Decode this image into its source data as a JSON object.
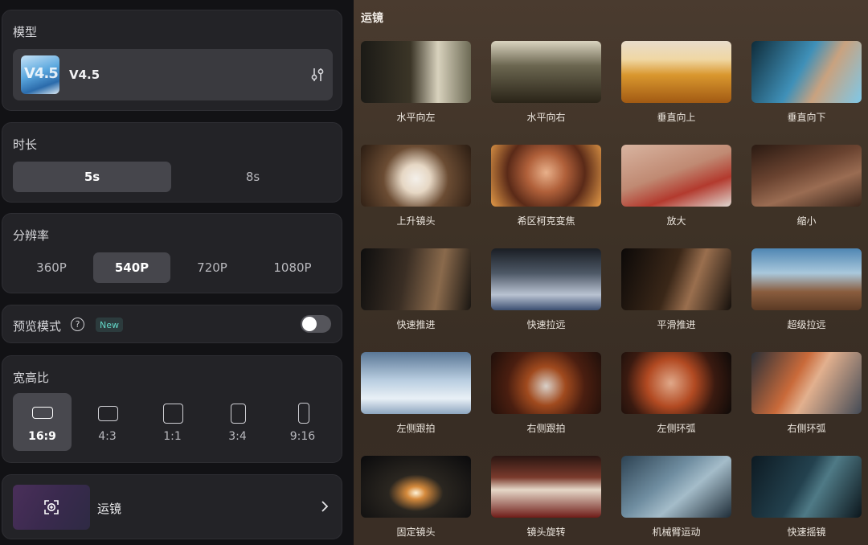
{
  "model": {
    "section_label": "模型",
    "name": "V4.5",
    "thumb_text": "V4.5",
    "settings_icon": "sliders-icon"
  },
  "duration": {
    "section_label": "时长",
    "options": [
      "5s",
      "8s"
    ],
    "selected": "5s"
  },
  "resolution": {
    "section_label": "分辨率",
    "options": [
      "360P",
      "540P",
      "720P",
      "1080P"
    ],
    "selected": "540P"
  },
  "preview": {
    "label": "预览模式",
    "help_icon": "question-circle-icon",
    "badge": "New",
    "enabled": false
  },
  "aspect": {
    "section_label": "宽高比",
    "options": [
      "16:9",
      "4:3",
      "1:1",
      "3:4",
      "9:16"
    ],
    "selected": "16:9"
  },
  "camera": {
    "label": "运镜",
    "icon": "focus-plus-icon",
    "chevron": "chevron-right-icon"
  },
  "panel": {
    "title": "运镜",
    "items": [
      "水平向左",
      "水平向右",
      "垂直向上",
      "垂直向下",
      "上升镜头",
      "希区柯克变焦",
      "放大",
      "缩小",
      "快速推进",
      "快速拉远",
      "平滑推进",
      "超级拉远",
      "左侧跟拍",
      "右侧跟拍",
      "左侧环弧",
      "右侧环弧",
      "固定镜头",
      "镜头旋转",
      "机械臂运动",
      "快速摇镜"
    ]
  },
  "colors": {
    "accent_badge": "#63d6c7",
    "active_button": "#46464c"
  }
}
